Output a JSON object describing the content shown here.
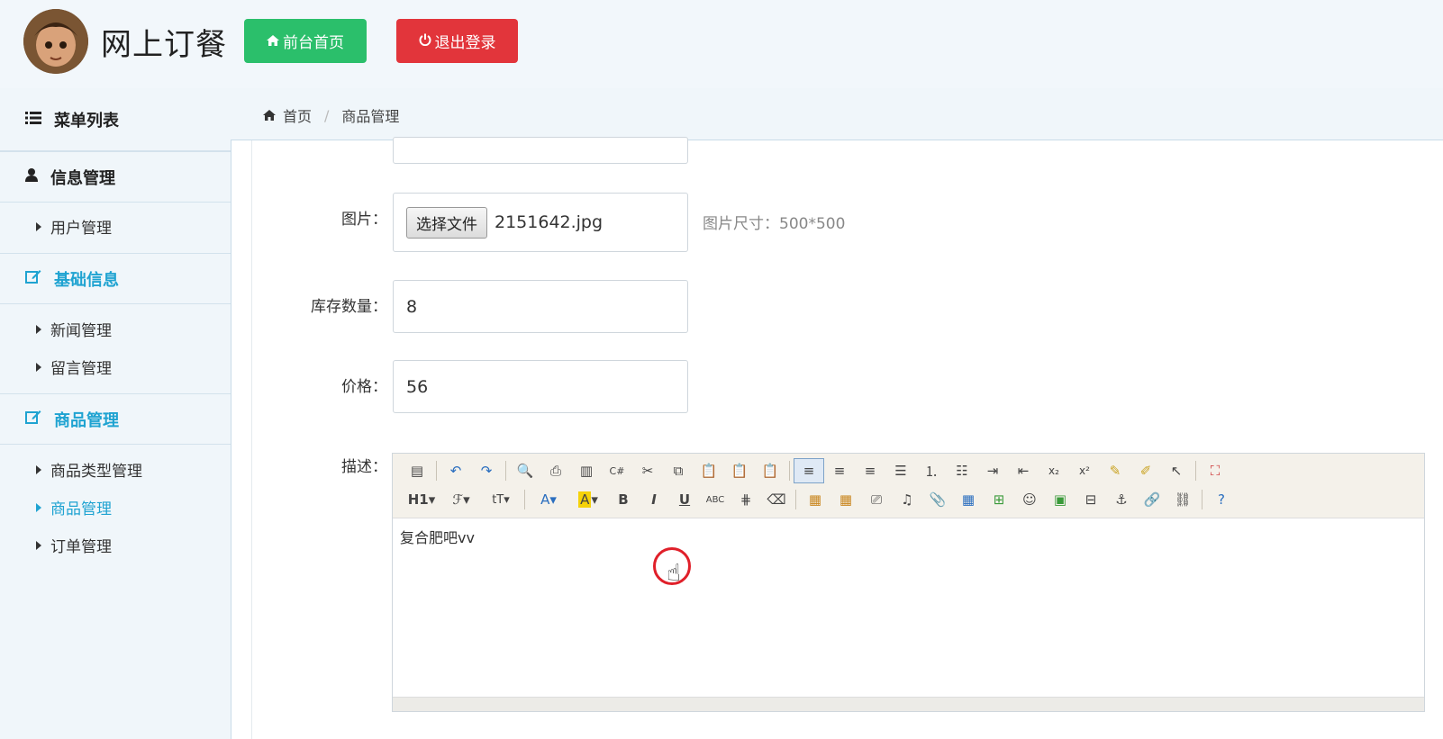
{
  "header": {
    "app_title": "网上订餐",
    "home_button": "前台首页",
    "logout_button": "退出登录",
    "home_icon": "home-icon",
    "power_icon": "power-icon"
  },
  "sidebar": {
    "menu_title": "菜单列表",
    "sections": [
      {
        "label": "信息管理",
        "icon": "user-icon",
        "items": [
          "用户管理"
        ]
      },
      {
        "label": "基础信息",
        "icon": "edit-icon",
        "items": [
          "新闻管理",
          "留言管理"
        ]
      },
      {
        "label": "商品管理",
        "icon": "edit-icon",
        "items": [
          "商品类型管理",
          "商品管理",
          "订单管理"
        ]
      }
    ]
  },
  "breadcrumb": {
    "home": "首页",
    "current": "商品管理"
  },
  "form": {
    "image_label": "图片：",
    "file_button": "选择文件",
    "file_name": "2151642.jpg",
    "image_hint": "图片尺寸：500*500",
    "stock_label": "库存数量：",
    "stock_value": "8",
    "price_label": "价格：",
    "price_value": "56",
    "desc_label": "描述：",
    "desc_value": "复合肥吧vv"
  },
  "colors": {
    "home_button": "#2bbf6b",
    "logout_button": "#e2353b",
    "accent": "#1fa3d1"
  }
}
